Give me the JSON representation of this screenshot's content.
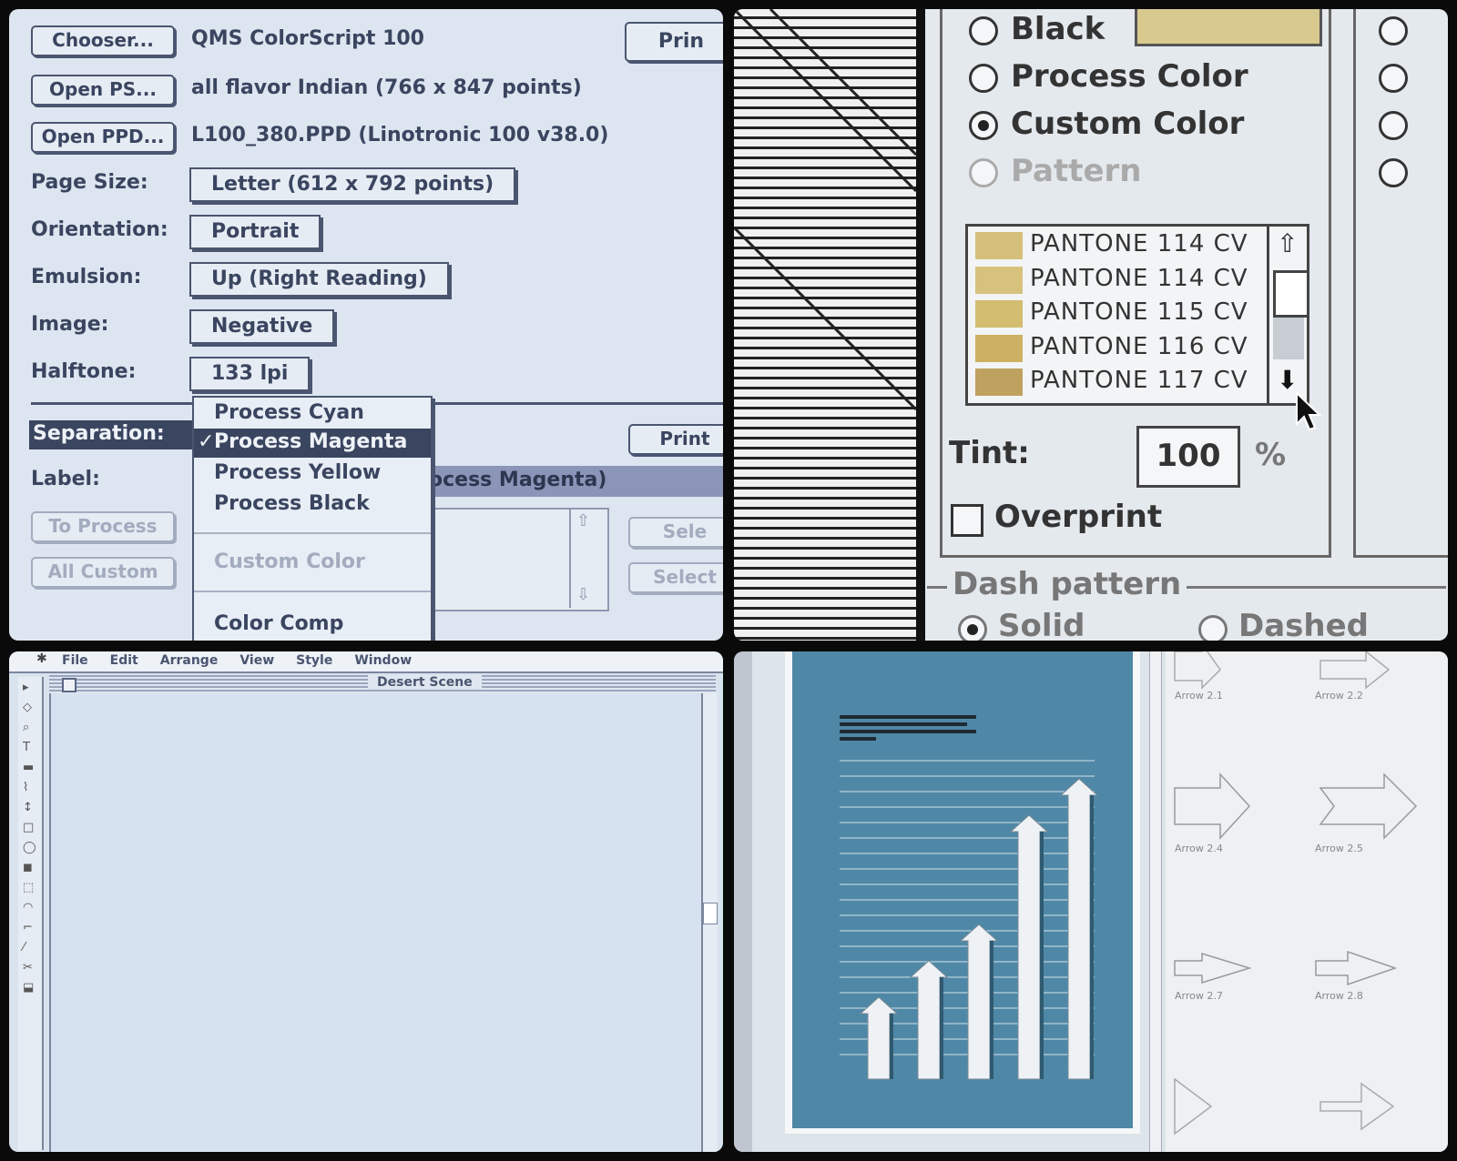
{
  "print_dialog": {
    "chooser_btn": "Chooser...",
    "chooser_val": "QMS ColorScript 100",
    "open_ps_btn": "Open PS...",
    "open_ps_val": "all flavor Indian (766 x 847 points)",
    "open_ppd_btn": "Open PPD...",
    "open_ppd_val": "L100_380.PPD (Linotronic 100 v38.0)",
    "print_btn": "Prin",
    "page_size_label": "Page Size:",
    "page_size_val": "Letter (612 x 792 points)",
    "orientation_label": "Orientation:",
    "orientation_val": "Portrait",
    "emulsion_label": "Emulsion:",
    "emulsion_val": "Up (Right Reading)",
    "image_label": "Image:",
    "image_val": "Negative",
    "halftone_label": "Halftone:",
    "halftone_val": "133 lpi",
    "separation_label": "Separation:",
    "label_label": "Label:",
    "label_field": "ocess Magenta)",
    "print2_btn": "Print",
    "to_process_btn": "To Process",
    "all_custom_btn": "All Custom",
    "select_btn1": "Sele",
    "select_btn2": "Select",
    "menu_items": [
      "Process Cyan",
      "Process Magenta",
      "Process Yellow",
      "Process Black",
      "Custom Color",
      "Color Comp"
    ],
    "checkmark": "✓"
  },
  "color_panel": {
    "radios": [
      "Black",
      "Process Color",
      "Custom Color",
      "Pattern"
    ],
    "pantone_list": [
      {
        "name": "PANTONE 114 CV",
        "color": "#d4c07a"
      },
      {
        "name": "PANTONE 114 CV",
        "color": "#d6c27d"
      },
      {
        "name": "PANTONE 115 CV",
        "color": "#d3bd70"
      },
      {
        "name": "PANTONE 116 CV",
        "color": "#cdb062"
      },
      {
        "name": "PANTONE 117 CV",
        "color": "#bfa260"
      }
    ],
    "tint_label": "Tint:",
    "tint_value": "100",
    "tint_unit": "%",
    "overprint_label": "Overprint",
    "dash_pattern_label": "Dash pattern",
    "solid_label": "Solid",
    "dashed_label": "Dashed",
    "swatch_color": "#d8c98e"
  },
  "drawing_app": {
    "menus": [
      "File",
      "Edit",
      "Arrange",
      "View",
      "Style",
      "Window"
    ],
    "window_title": "Desert Scene"
  },
  "arrows_panel": {
    "arrow_labels": [
      "Arrow 2.1",
      "Arrow 2.2",
      "Arrow 2.4",
      "Arrow 2.5",
      "Arrow 2.7",
      "Arrow 2.8"
    ],
    "page_bg": "#4f88a6"
  }
}
